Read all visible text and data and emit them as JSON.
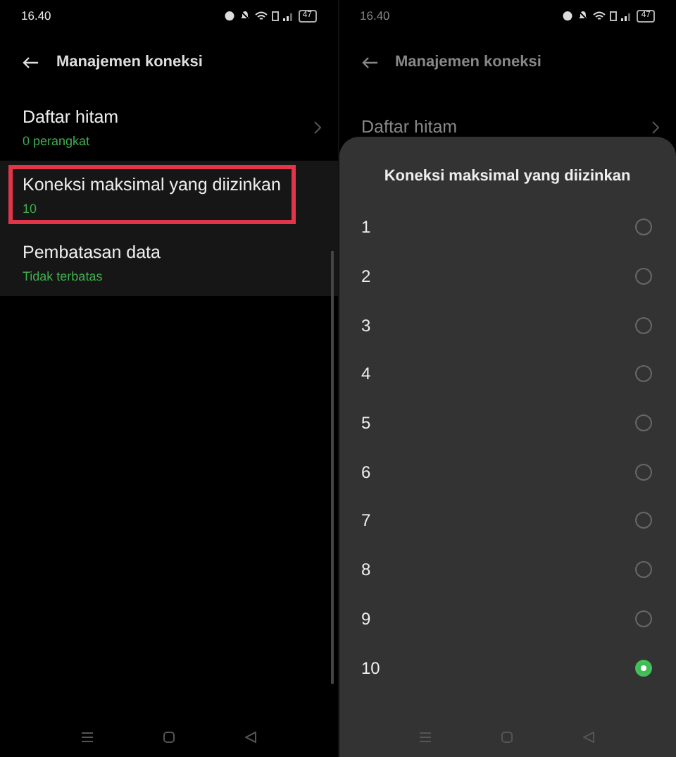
{
  "screens": [
    {
      "status_bar": {
        "time": "16.40",
        "battery": "47"
      },
      "header": {
        "title": "Manajemen koneksi"
      },
      "items": [
        {
          "title": "Daftar hitam",
          "value": "0 perangkat",
          "chevron": true,
          "highlighted": false,
          "annotated": false
        },
        {
          "title": "Koneksi maksimal yang diizinkan",
          "value": "10",
          "chevron": false,
          "highlighted": true,
          "annotated": true
        },
        {
          "title": "Pembatasan data",
          "value": "Tidak terbatas",
          "chevron": false,
          "highlighted": true,
          "annotated": false
        }
      ]
    },
    {
      "status_bar": {
        "time": "16.40",
        "battery": "47"
      },
      "header": {
        "title": "Manajemen koneksi"
      },
      "items": [
        {
          "title": "Daftar hitam",
          "chevron": true,
          "highlighted": false,
          "annotated": false
        }
      ],
      "sheet": {
        "title": "Koneksi maksimal yang diizinkan",
        "options": [
          {
            "label": "1",
            "selected": false
          },
          {
            "label": "2",
            "selected": false
          },
          {
            "label": "3",
            "selected": false
          },
          {
            "label": "4",
            "selected": false
          },
          {
            "label": "5",
            "selected": false
          },
          {
            "label": "6",
            "selected": false
          },
          {
            "label": "7",
            "selected": false
          },
          {
            "label": "8",
            "selected": false
          },
          {
            "label": "9",
            "selected": false
          },
          {
            "label": "10",
            "selected": true
          }
        ]
      }
    }
  ]
}
